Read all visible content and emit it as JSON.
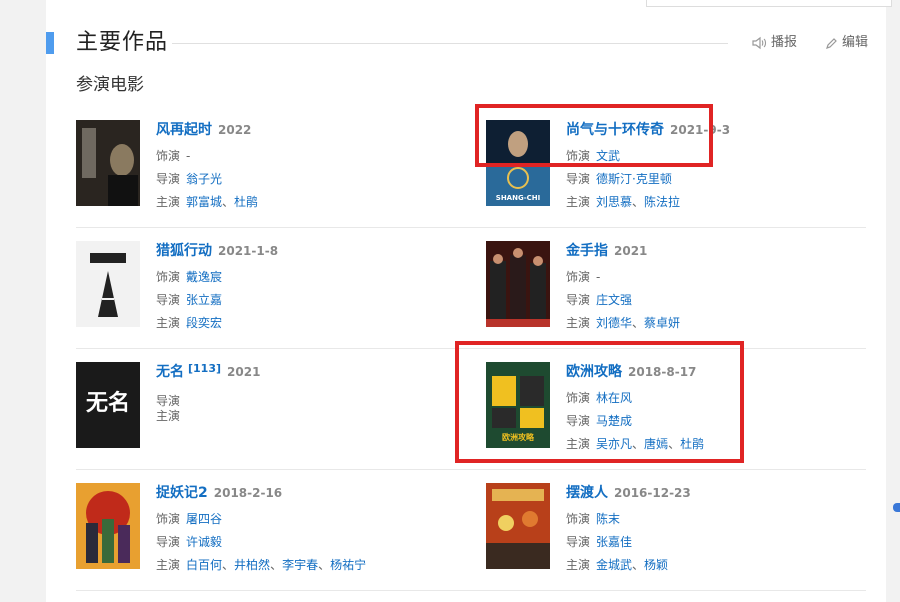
{
  "section": {
    "title": "主要作品",
    "report_label": "播报",
    "edit_label": "编辑",
    "subtitle": "参演电影"
  },
  "labels": {
    "role": "饰演",
    "director": "导演",
    "cast": "主演"
  },
  "movies": [
    {
      "title": "风再起时",
      "date": "2022",
      "role": "-",
      "director": [
        "翁子光"
      ],
      "cast": [
        "郭富城",
        "杜鹃"
      ],
      "poster_palette": [
        "#2a2520",
        "#8a7a60",
        "#d8cfc0"
      ]
    },
    {
      "title": "尚气与十环传奇",
      "date": "2021-9-3",
      "role": "文武",
      "director": [
        "德斯汀·克里顿"
      ],
      "cast": [
        "刘思慕",
        "陈法拉"
      ],
      "poster_text": "SHANG-CHI",
      "poster_palette": [
        "#0e1f33",
        "#2a6a9a",
        "#c8d6e4"
      ]
    },
    {
      "title": "猎狐行动",
      "date": "2021-1-8",
      "role": "戴逸宸",
      "director": [
        "张立嘉"
      ],
      "cast": [
        "段奕宏"
      ],
      "poster_palette": [
        "#f2f2f2",
        "#222222",
        "#9a9a9a"
      ]
    },
    {
      "title": "金手指",
      "date": "2021",
      "role": "-",
      "director": [
        "庄文强"
      ],
      "cast": [
        "刘德华",
        "蔡卓妍"
      ],
      "poster_palette": [
        "#3a1410",
        "#b8332a",
        "#e0b060"
      ]
    },
    {
      "title": "无名",
      "sup": "[113]",
      "date": "2021",
      "role": "",
      "director": [],
      "cast": [],
      "poster_text": "无名",
      "poster_palette": [
        "#1a1a1a",
        "#ffffff",
        "#555555"
      ]
    },
    {
      "title": "欧洲攻略",
      "date": "2018-8-17",
      "role": "林在风",
      "director": [
        "马楚成"
      ],
      "cast": [
        "吴亦凡",
        "唐嫣",
        "杜鹃"
      ],
      "poster_text": "欧洲攻略",
      "poster_palette": [
        "#1e4a30",
        "#f0c020",
        "#2a2a2a"
      ]
    },
    {
      "title": "捉妖记2",
      "date": "2018-2-16",
      "role": "屠四谷",
      "director": [
        "许诚毅"
      ],
      "cast": [
        "白百何",
        "井柏然",
        "李宇春",
        "杨祐宁"
      ],
      "poster_palette": [
        "#e8a030",
        "#c02a1a",
        "#3a6a3a"
      ]
    },
    {
      "title": "摆渡人",
      "date": "2016-12-23",
      "role": "陈末",
      "director": [
        "张嘉佳"
      ],
      "cast": [
        "金城武",
        "杨颖"
      ],
      "poster_palette": [
        "#b8401a",
        "#f0d060",
        "#3a2a20"
      ]
    }
  ]
}
